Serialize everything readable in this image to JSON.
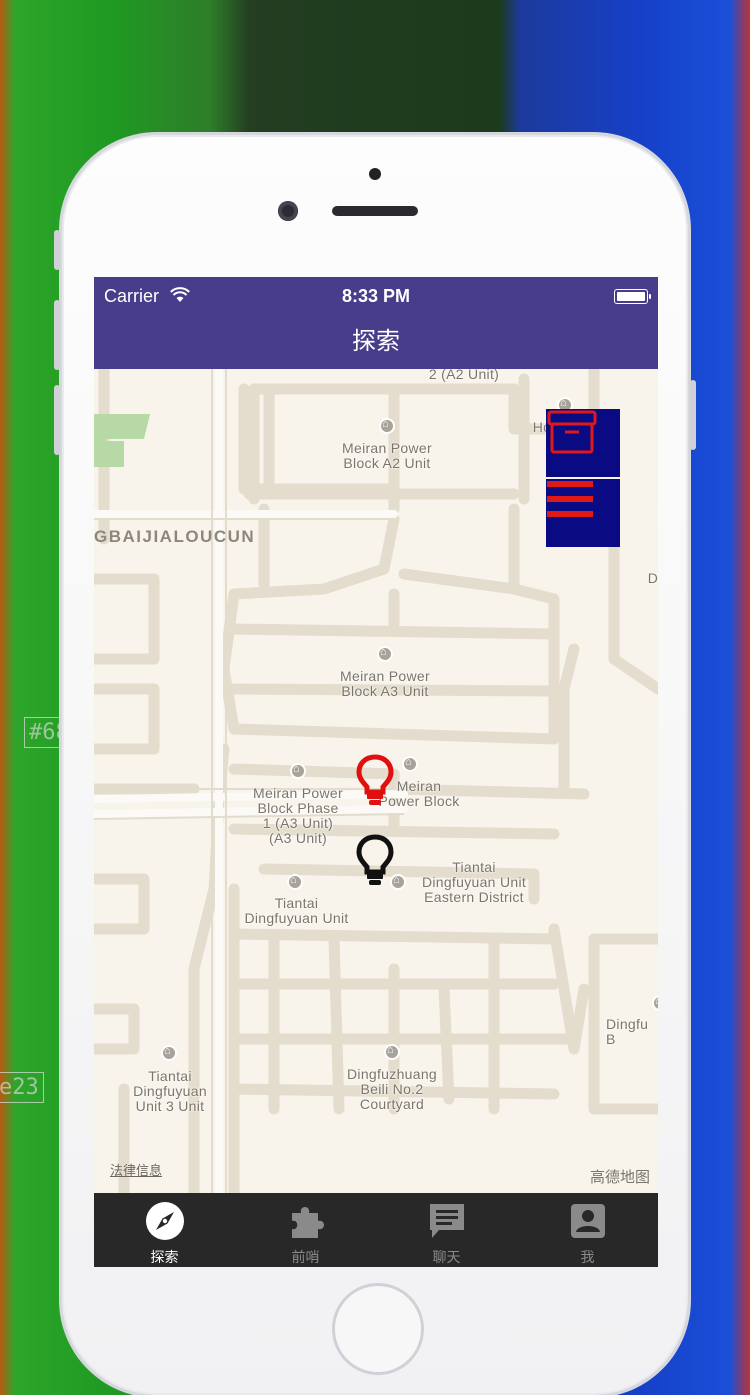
{
  "background": {
    "tag_left": "#68",
    "tag_bottom": "e23"
  },
  "status_bar": {
    "carrier": "Carrier",
    "time": "8:33 PM"
  },
  "nav": {
    "title": "探索"
  },
  "map": {
    "road_label": "GBAIJIALOUCUN",
    "labels": [
      {
        "text": "2 (A2 Unit)"
      },
      {
        "text": "Meiran Power\nBlock A2 Unit"
      },
      {
        "text": "Ho"
      },
      {
        "text": "D"
      },
      {
        "text": "Meiran Power\nBlock A3 Unit"
      },
      {
        "text": "Meiran Power\nBlock Phase\n1 (A3 Unit)\n(A3 Unit)"
      },
      {
        "text": "Meiran\nPower Block"
      },
      {
        "text": "Tiantai\nDingfuyuan Unit\nEastern District"
      },
      {
        "text": "Tiantai\nDingfuyuan Unit"
      },
      {
        "text": "Dingfu\nB"
      },
      {
        "text": "Tiantai\nDingfuyuan\nUnit 3 Unit"
      },
      {
        "text": "Dingfuzhuang\nBeili No.2\nCourtyard"
      }
    ],
    "legal_link": "法律信息",
    "watermark": "高德地图"
  },
  "controls": {
    "archive_icon": "archive-box-icon",
    "menu_icon": "hamburger-menu-icon",
    "color_bg": "#0a0a82",
    "color_icon": "#e01818"
  },
  "pins": [
    {
      "icon": "lightbulb-icon",
      "color": "#e01010"
    },
    {
      "icon": "lightbulb-icon",
      "color": "#111111"
    }
  ],
  "tab_bar": {
    "tabs": [
      {
        "label": "探索",
        "icon": "compass-icon",
        "active": true
      },
      {
        "label": "前哨",
        "icon": "puzzle-icon",
        "active": false
      },
      {
        "label": "聊天",
        "icon": "chat-bubble-icon",
        "active": false
      },
      {
        "label": "我",
        "icon": "person-icon",
        "active": false
      }
    ]
  }
}
